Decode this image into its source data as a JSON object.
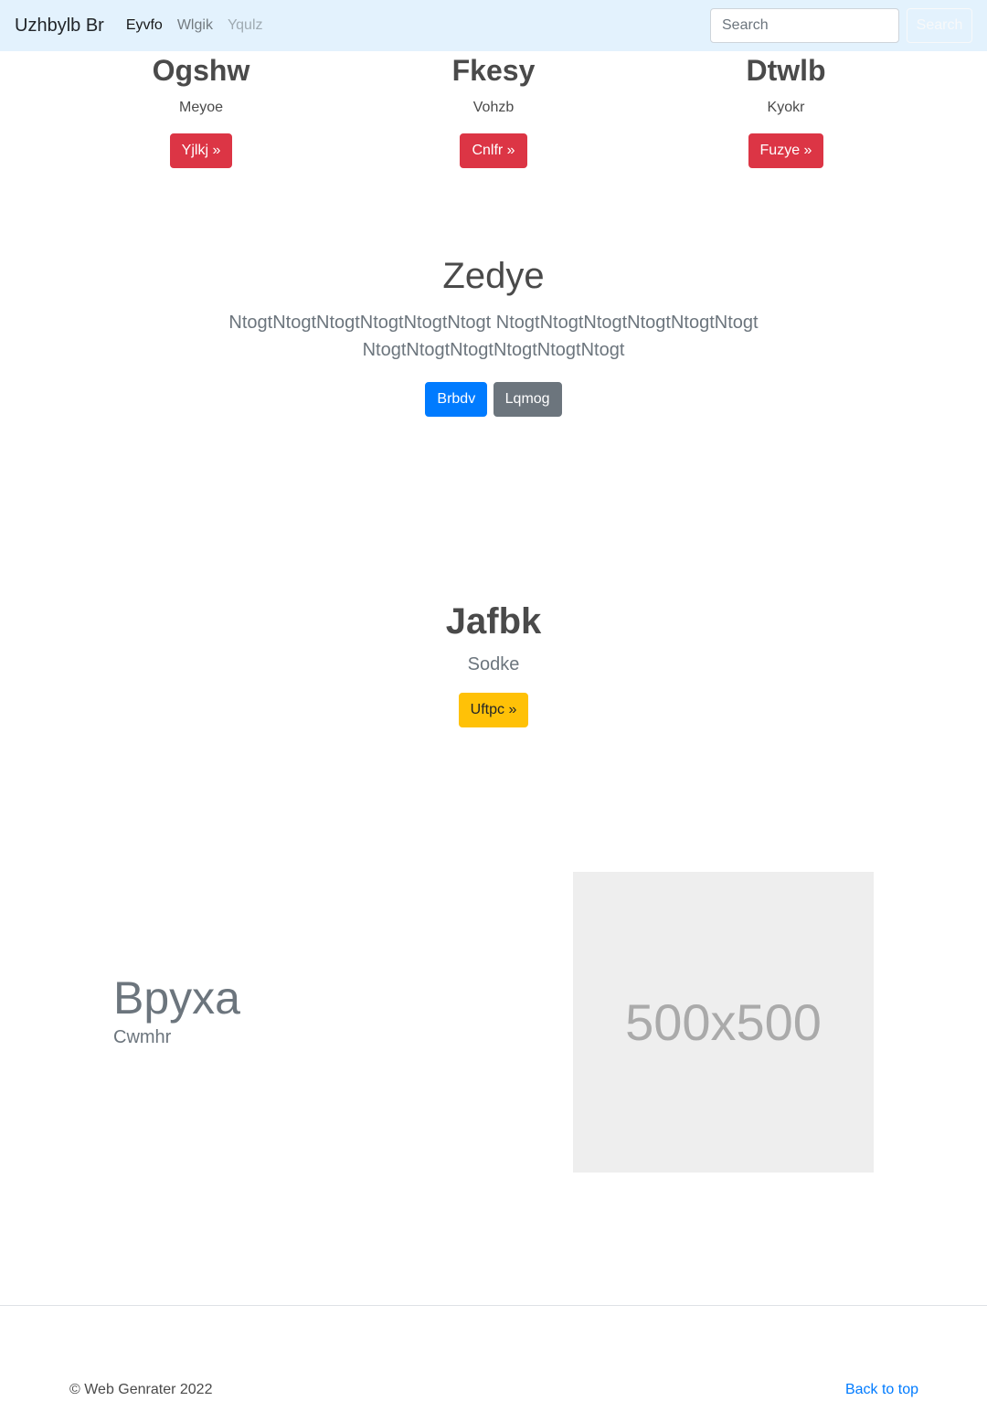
{
  "navbar": {
    "brand": "Uzhbylb Br",
    "links": [
      {
        "label": "Eyvfo",
        "state": "active"
      },
      {
        "label": "Wlgik",
        "state": "normal"
      },
      {
        "label": "Yqulz",
        "state": "disabled"
      }
    ],
    "search": {
      "placeholder": "Search",
      "button_label": "Search"
    }
  },
  "features": [
    {
      "title": "Ogshw",
      "text": "Meyoe",
      "button": "Yjlkj »"
    },
    {
      "title": "Fkesy",
      "text": "Vohzb",
      "button": "Cnlfr »"
    },
    {
      "title": "Dtwlb",
      "text": "Kyokr",
      "button": "Fuzye »"
    }
  ],
  "jumbotron": {
    "title": "Zedye",
    "lead": "NtogtNtogtNtogtNtogtNtogtNtogt NtogtNtogtNtogtNtogtNtogtNtogt NtogtNtogtNtogtNtogtNtogtNtogt",
    "primary_button": "Brbdv",
    "secondary_button": "Lqmog"
  },
  "feature2": {
    "title": "Jafbk",
    "text": "Sodke",
    "button": "Uftpc »"
  },
  "hero": {
    "title": "Bpyxa",
    "subtitle": "Cwmhr",
    "image_label": "500x500"
  },
  "footer": {
    "copyright": "© Web Genrater 2022",
    "back_to_top": "Back to top"
  },
  "colors": {
    "navbar_bg": "#e3f2fd",
    "danger": "#dc3545",
    "primary": "#007bff",
    "secondary": "#6c757d",
    "warning": "#ffc107",
    "placeholder_bg": "#eeeeee"
  }
}
